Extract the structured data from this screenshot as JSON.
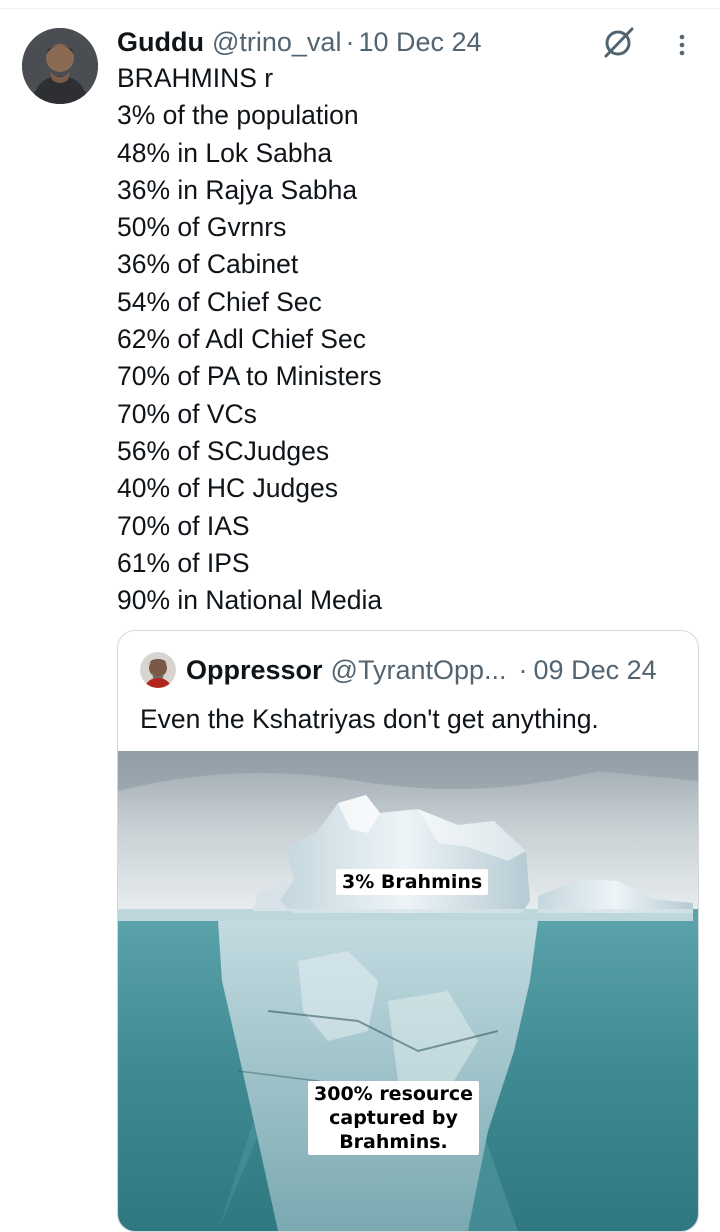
{
  "tweet": {
    "author_name": "Guddu",
    "handle": "@trino_val",
    "separator": "·",
    "date": "10 Dec 24",
    "avatar_icon": "user-avatar-photo",
    "lines": [
      "BRAHMINS r",
      "3% of the population",
      "48% in Lok Sabha",
      "36% in Rajya Sabha",
      "50% of Gvrnrs",
      "36% of Cabinet",
      "54% of Chief Sec",
      "62% of Adl Chief Sec",
      "70% of PA to Ministers",
      "70% of VCs",
      "56% of SCJudges",
      "40% of HC Judges",
      "70% of IAS",
      "61% of IPS",
      "90% in National Media"
    ],
    "actions": {
      "grok_icon": "grok-icon",
      "more_icon": "more-options-icon"
    }
  },
  "quoted_tweet": {
    "author_name": "Oppressor",
    "handle": "@TyrantOpp...",
    "separator": "·",
    "date": "09 Dec 24",
    "text": "Even the Kshatriyas don't get anything.",
    "media": {
      "description_icon": "iceberg-image",
      "caption_top": "3% Brahmins",
      "caption_bottom": "300% resource\ncaptured by\nBrahmins."
    }
  },
  "colors": {
    "text_primary": "#0f1419",
    "text_secondary": "#536471",
    "border": "#cfd9de",
    "water": "#3f8d95",
    "ice": "#dbe8ee"
  }
}
